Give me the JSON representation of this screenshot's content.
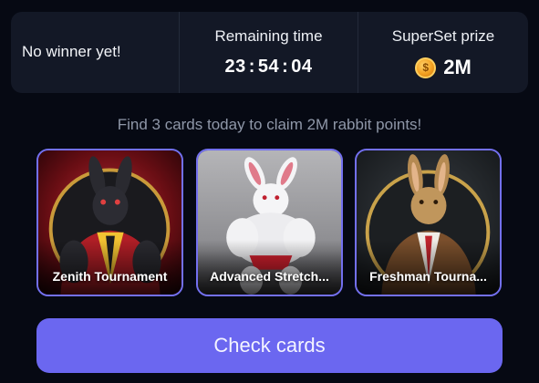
{
  "stats": {
    "winner_text": "No winner yet!",
    "remaining_label": "Remaining time",
    "timer": {
      "hours": "23",
      "minutes": "54",
      "seconds": "04",
      "separator": ":"
    },
    "prize_label": "SuperSet prize",
    "prize_value": "2M",
    "coin_symbol": "$"
  },
  "subtitle": "Find 3 cards today to claim 2M rabbit points!",
  "cards": [
    {
      "name": "Zenith Tournament",
      "image": "dark-rabbit-red-suit"
    },
    {
      "name": "Advanced Stretch...",
      "image": "white-rabbit-red-shorts"
    },
    {
      "name": "Freshman Tourna...",
      "image": "brown-rabbit-brown-suit"
    }
  ],
  "check_button_label": "Check cards",
  "colors": {
    "accent": "#6b67f0",
    "card_border": "#7370f0",
    "background": "#060913",
    "panel": "#131826"
  }
}
